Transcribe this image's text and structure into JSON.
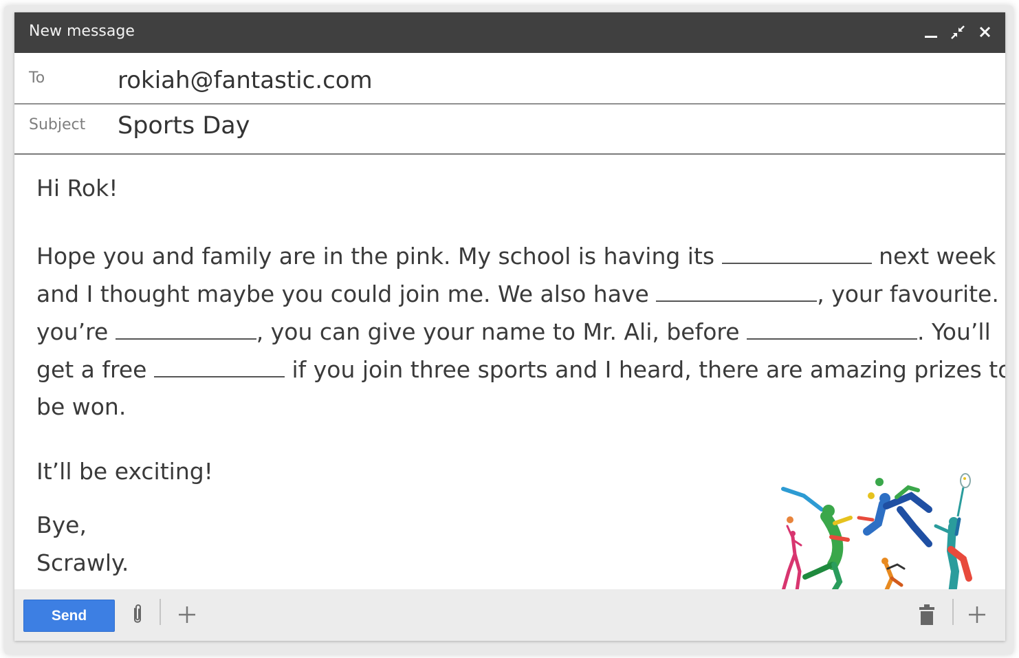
{
  "window": {
    "title": "New message",
    "controls": {
      "minimize": "minimize-icon",
      "expand": "expand-icon",
      "close": "close-icon"
    }
  },
  "fields": {
    "to": {
      "label": "To",
      "value": "rokiah@fantastic.com"
    },
    "subject": {
      "label": "Subject",
      "value": "Sports Day"
    }
  },
  "body": {
    "greeting": "Hi Rok!",
    "p1_l1_a": "Hope you and family are in the pink. My school is having its ",
    "p1_l1_b": " next week",
    "p1_l2_a": "and I thought maybe you could join me. We also have ",
    "p1_l2_b": ", your favourite. If",
    "p1_l3_a": "you’re ",
    "p1_l3_b": ", you can give your name to Mr. Ali, before ",
    "p1_l3_c": ". You’ll",
    "p1_l4_a": "get a free ",
    "p1_l4_b": " if you join three sports and I heard, there are amazing prizes to",
    "p1_l5": "be won.",
    "closing": "It’ll be exciting!",
    "signoff": "Bye,",
    "signature": "Scrawly."
  },
  "footer": {
    "send_label": "Send",
    "icons": [
      "attach-icon",
      "more-options-icon",
      "trash-icon",
      "add-icon"
    ]
  },
  "colors": {
    "titlebar": "#404040",
    "send_button": "#3d7fe3",
    "footer": "#ececec"
  }
}
